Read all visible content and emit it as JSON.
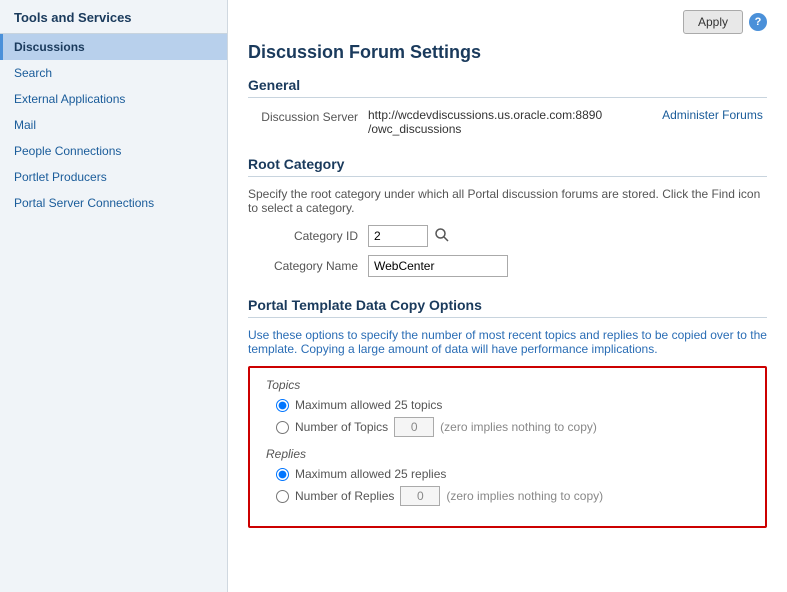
{
  "sidebar": {
    "title": "Tools and Services",
    "items": [
      {
        "id": "discussions",
        "label": "Discussions",
        "active": true
      },
      {
        "id": "search",
        "label": "Search",
        "active": false
      },
      {
        "id": "external-applications",
        "label": "External Applications",
        "active": false
      },
      {
        "id": "mail",
        "label": "Mail",
        "active": false
      },
      {
        "id": "people-connections",
        "label": "People Connections",
        "active": false
      },
      {
        "id": "portlet-producers",
        "label": "Portlet Producers",
        "active": false
      },
      {
        "id": "portal-server-connections",
        "label": "Portal Server Connections",
        "active": false
      }
    ]
  },
  "header": {
    "apply_label": "Apply",
    "help_icon": "?"
  },
  "main": {
    "page_title": "Discussion Forum Settings",
    "general": {
      "section_title": "General",
      "field_label": "Discussion Server",
      "field_value_line1": "http://wcdevdiscussions.us.oracle.com:8890",
      "field_value_line2": "/owc_discussions",
      "admin_link": "Administer Forums"
    },
    "root_category": {
      "section_title": "Root Category",
      "description": "Specify the root category under which all Portal discussion forums are stored. Click the Find icon to select a category.",
      "category_id_label": "Category ID",
      "category_id_value": "2",
      "category_name_label": "Category Name",
      "category_name_value": "WebCenter"
    },
    "portal_template": {
      "section_title": "Portal Template Data Copy Options",
      "description": "Use these options to specify the number of most recent topics and replies to be copied over to the template. Copying a large amount of data will have performance implications.",
      "options": {
        "topics_group": "Topics",
        "topics_max_label": "Maximum allowed 25 topics",
        "topics_number_label": "Number of Topics",
        "topics_number_value": "0",
        "topics_zero_hint": "(zero implies nothing to copy)",
        "replies_group": "Replies",
        "replies_max_label": "Maximum allowed 25 replies",
        "replies_number_label": "Number of Replies",
        "replies_number_value": "0",
        "replies_zero_hint": "(zero implies nothing to copy)"
      }
    }
  }
}
